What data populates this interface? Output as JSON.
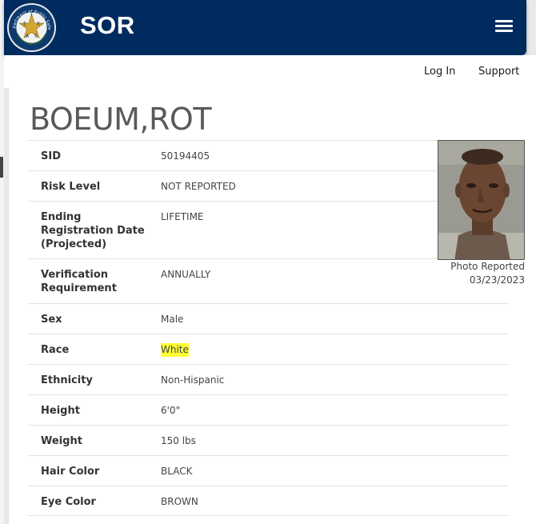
{
  "header": {
    "brand": "SOR",
    "seal_text": "Department of Public Safety",
    "seal_letters": [
      "T",
      "E",
      "X",
      "A",
      "S"
    ]
  },
  "nav": {
    "login": "Log In",
    "support": "Support"
  },
  "record": {
    "name": "BOEUM,ROT",
    "rows": [
      {
        "label": "SID",
        "value": "50194405"
      },
      {
        "label": "Risk Level",
        "value": "NOT REPORTED"
      },
      {
        "label": "Ending Registration Date (Projected)",
        "value": "LIFETIME"
      },
      {
        "label": "Verification Requirement",
        "value": "ANNUALLY"
      },
      {
        "label": "Sex",
        "value": "Male"
      },
      {
        "label": "Race",
        "value": "White"
      },
      {
        "label": "Ethnicity",
        "value": "Non-Hispanic"
      },
      {
        "label": "Height",
        "value": "6'0\""
      },
      {
        "label": "Weight",
        "value": "150 lbs"
      },
      {
        "label": "Hair Color",
        "value": "BLACK"
      },
      {
        "label": "Eye Color",
        "value": "BROWN"
      }
    ]
  },
  "photo": {
    "caption_line1": "Photo Reported",
    "caption_line2": "03/23/2023"
  },
  "colors": {
    "header_bg": "#002b5f",
    "highlight": "#ffff33"
  },
  "icons": [
    "dps-seal-logo",
    "hamburger-menu-icon"
  ]
}
